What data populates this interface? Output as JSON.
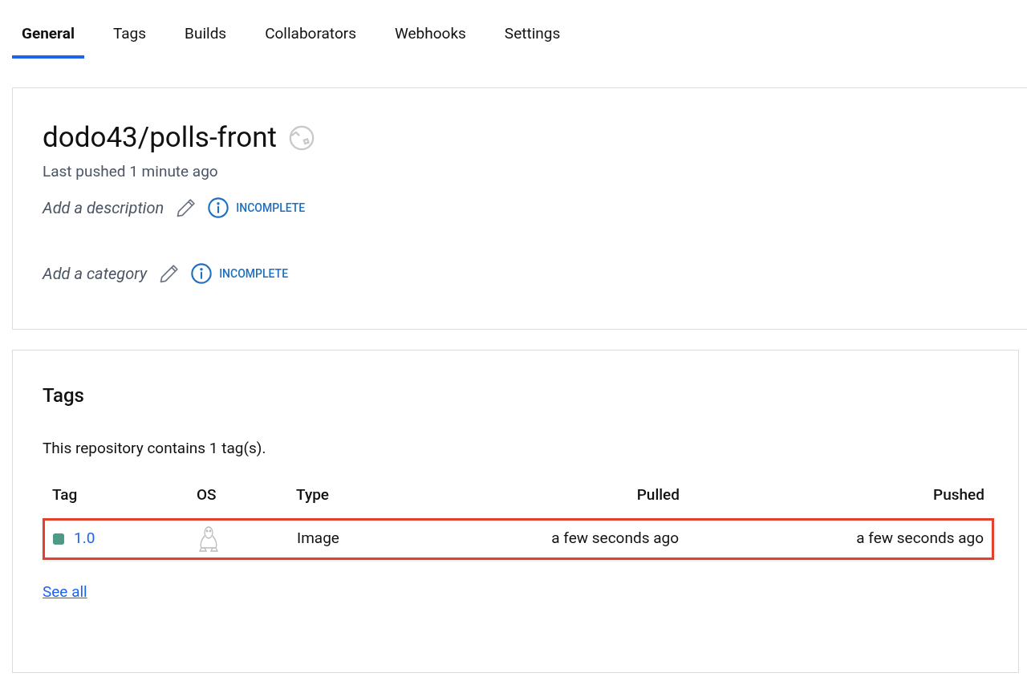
{
  "tabs": [
    {
      "label": "General",
      "selected": true
    },
    {
      "label": "Tags",
      "selected": false
    },
    {
      "label": "Builds",
      "selected": false
    },
    {
      "label": "Collaborators",
      "selected": false
    },
    {
      "label": "Webhooks",
      "selected": false
    },
    {
      "label": "Settings",
      "selected": false
    }
  ],
  "repository": {
    "name": "dodo43/polls-front",
    "last_pushed": "Last pushed 1 minute ago",
    "fields": [
      {
        "placeholder": "Add a description",
        "status": "INCOMPLETE"
      },
      {
        "placeholder": "Add a category",
        "status": "INCOMPLETE"
      }
    ]
  },
  "tags_card": {
    "title": "Tags",
    "summary": "This repository contains 1 tag(s).",
    "table": {
      "columns": [
        "Tag",
        "OS",
        "Type",
        "Pulled",
        "Pushed"
      ],
      "rows": [
        {
          "tag": "1.0",
          "color": "#4e9a85",
          "type": "Image",
          "pulled": "a few seconds ago",
          "pushed": "a few seconds ago",
          "highlighted": true
        }
      ]
    },
    "see_all": "See all"
  }
}
